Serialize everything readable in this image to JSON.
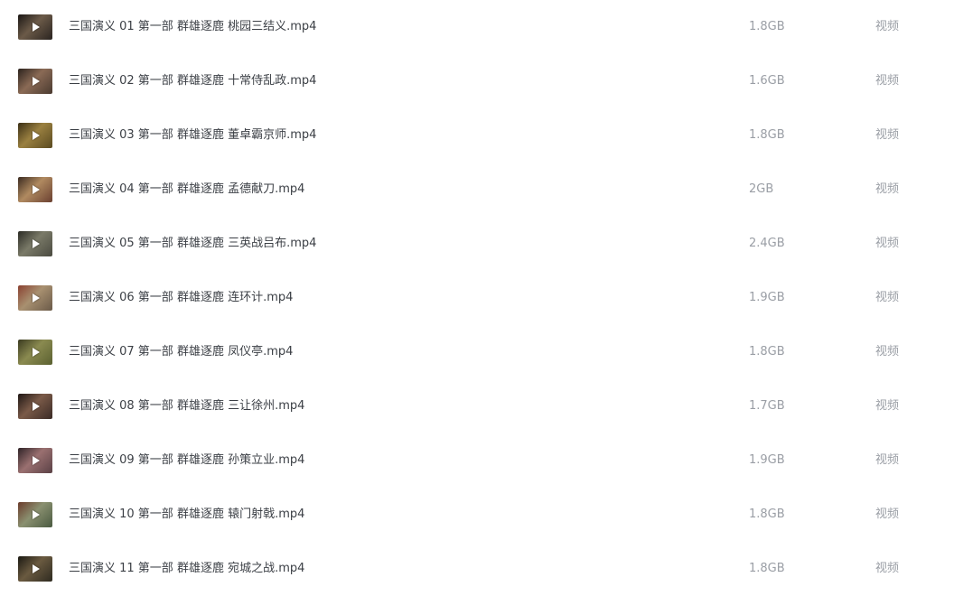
{
  "files": [
    {
      "name": "三国演义 01 第一部 群雄逐鹿 桃园三结义.mp4",
      "size": "1.8GB",
      "type": "视频",
      "thumb_colors": [
        "#2a2420",
        "#6b5a48",
        "#1a1614"
      ]
    },
    {
      "name": "三国演义 02 第一部 群雄逐鹿 十常侍乱政.mp4",
      "size": "1.6GB",
      "type": "视频",
      "thumb_colors": [
        "#4a3a30",
        "#8a6a55",
        "#2b221d"
      ]
    },
    {
      "name": "三国演义 03 第一部 群雄逐鹿 董卓霸京师.mp4",
      "size": "1.8GB",
      "type": "视频",
      "thumb_colors": [
        "#5a4a20",
        "#9a8040",
        "#3a2e15"
      ]
    },
    {
      "name": "三国演义 04 第一部 群雄逐鹿 孟德献刀.mp4",
      "size": "2GB",
      "type": "视频",
      "thumb_colors": [
        "#6a4030",
        "#b08a60",
        "#3a2a20"
      ]
    },
    {
      "name": "三国演义 05 第一部 群雄逐鹿 三英战吕布.mp4",
      "size": "2.4GB",
      "type": "视频",
      "thumb_colors": [
        "#4a4a40",
        "#7a7a68",
        "#2a2a24"
      ]
    },
    {
      "name": "三国演义 06 第一部 群雄逐鹿 连环计.mp4",
      "size": "1.9GB",
      "type": "视频",
      "thumb_colors": [
        "#6a5a48",
        "#a89070",
        "#8a4030"
      ]
    },
    {
      "name": "三国演义 07 第一部 群雄逐鹿 凤仪亭.mp4",
      "size": "1.8GB",
      "type": "视频",
      "thumb_colors": [
        "#5a6030",
        "#8a8a50",
        "#3a3a20"
      ]
    },
    {
      "name": "三国演义 08 第一部 群雄逐鹿 三让徐州.mp4",
      "size": "1.7GB",
      "type": "视频",
      "thumb_colors": [
        "#3a2a25",
        "#7a5a48",
        "#1e1614"
      ]
    },
    {
      "name": "三国演义 09 第一部 群雄逐鹿 孙策立业.mp4",
      "size": "1.9GB",
      "type": "视频",
      "thumb_colors": [
        "#5a4045",
        "#9a7070",
        "#2e2226"
      ]
    },
    {
      "name": "三国演义 10 第一部 群雄逐鹿 辕门射戟.mp4",
      "size": "1.8GB",
      "type": "视频",
      "thumb_colors": [
        "#4a5a40",
        "#8a9070",
        "#6a3a2a"
      ]
    },
    {
      "name": "三国演义 11 第一部 群雄逐鹿 宛城之战.mp4",
      "size": "1.8GB",
      "type": "视频",
      "thumb_colors": [
        "#2e2a20",
        "#6a5a40",
        "#1a1812"
      ]
    }
  ]
}
